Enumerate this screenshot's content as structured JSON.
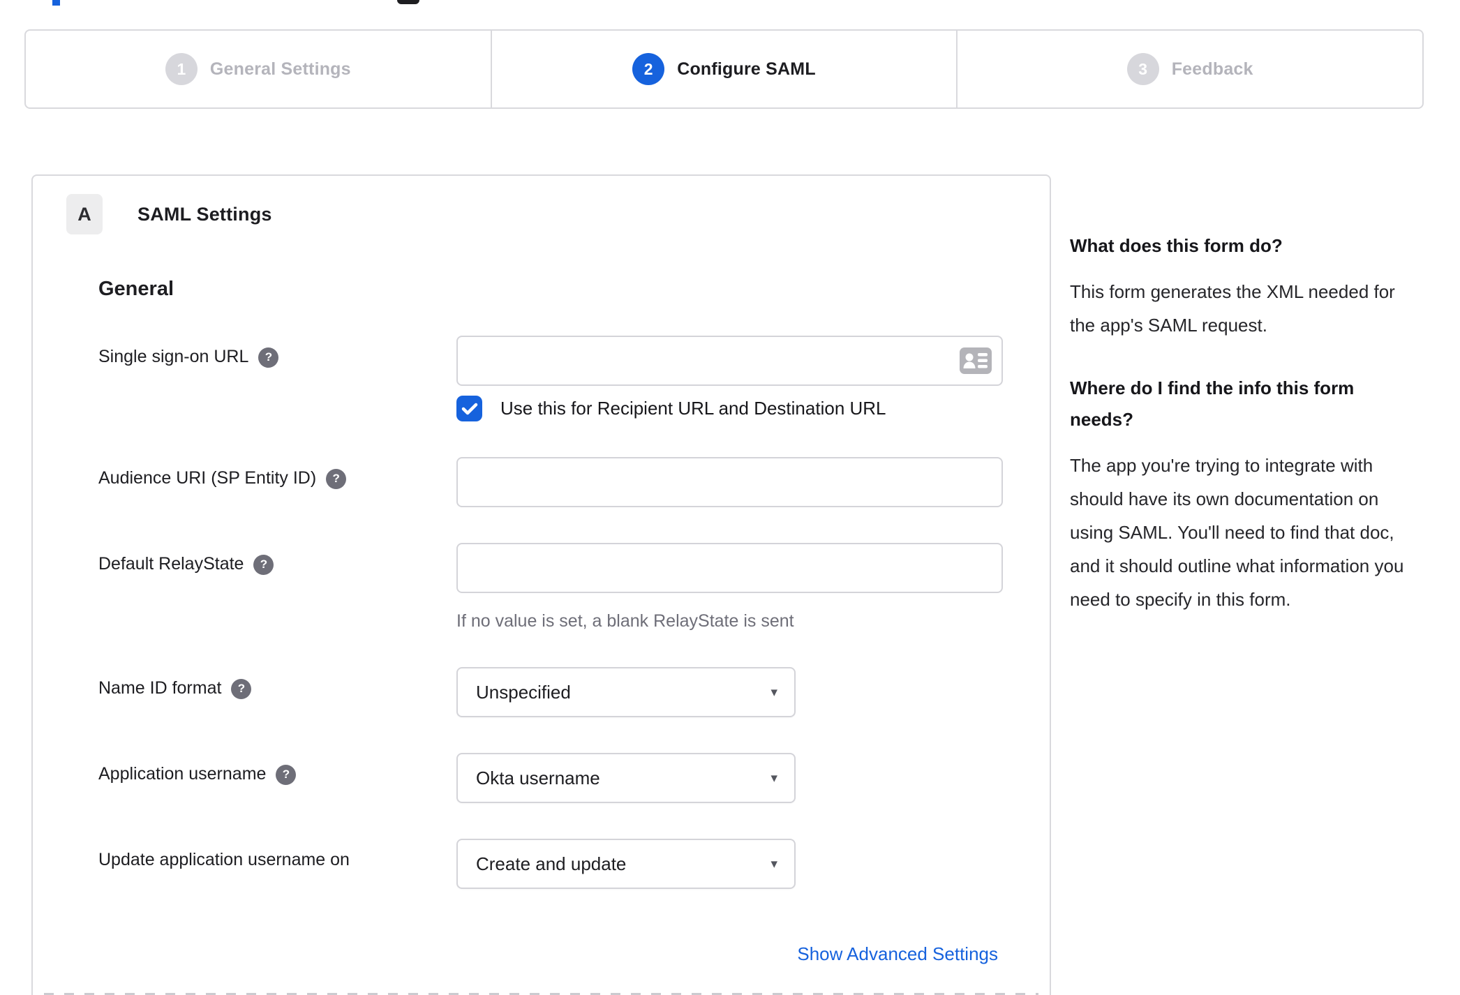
{
  "colors": {
    "accent": "#1662dd",
    "inactive_circle": "#d7d7dc",
    "border": "#d9d9dd",
    "muted_text": "#6e6e78"
  },
  "glyphs": {
    "help": "?",
    "dropdown_arrow": "▾"
  },
  "stepper": {
    "steps": [
      {
        "number": "1",
        "label": "General Settings",
        "state": "inactive"
      },
      {
        "number": "2",
        "label": "Configure SAML",
        "state": "active"
      },
      {
        "number": "3",
        "label": "Feedback",
        "state": "inactive"
      }
    ]
  },
  "panel": {
    "badge": "A",
    "title": "SAML Settings",
    "section_heading": "General",
    "fields": [
      {
        "label": "Single sign-on URL",
        "type": "text",
        "value": "",
        "icon": "contact-card"
      },
      {
        "label": "Audience URI (SP Entity ID)",
        "type": "text",
        "value": ""
      },
      {
        "label": "Default RelayState",
        "type": "text",
        "value": "",
        "hint": "If no value is set, a blank RelayState is sent"
      },
      {
        "label": "Name ID format",
        "type": "select",
        "value": "Unspecified"
      },
      {
        "label": "Application username",
        "type": "select",
        "value": "Okta username"
      },
      {
        "label": "Update application username on",
        "type": "select",
        "value": "Create and update"
      }
    ],
    "checkbox": {
      "checked": true,
      "label": "Use this for Recipient URL and Destination URL"
    },
    "advanced_link": "Show Advanced Settings"
  },
  "sidebar": {
    "section1_heading": "What does this form do?",
    "section1_body": "This form generates the XML needed for the app's SAML request.",
    "section2_heading": "Where do I find the info this form needs?",
    "section2_body": "The app you're trying to integrate with should have its own documentation on using SAML. You'll need to find that doc, and it should outline what information you need to specify in this form."
  }
}
